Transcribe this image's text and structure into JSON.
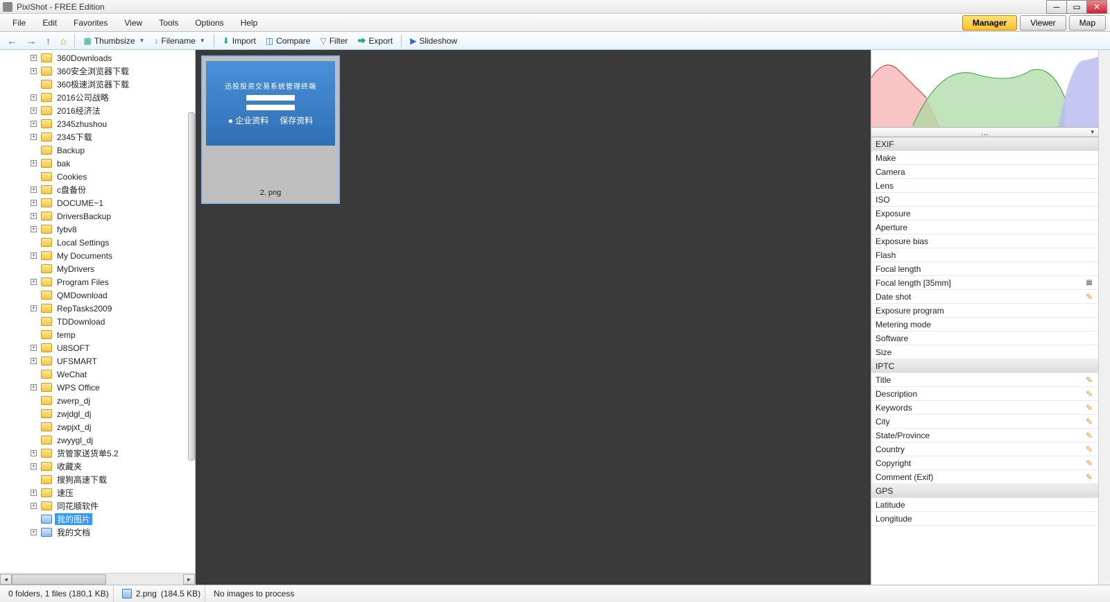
{
  "title": "PixiShot  -  FREE Edition",
  "menus": [
    "File",
    "Edit",
    "Favorites",
    "View",
    "Tools",
    "Options",
    "Help"
  ],
  "modes": [
    {
      "label": "Manager",
      "active": true
    },
    {
      "label": "Viewer",
      "active": false
    },
    {
      "label": "Map",
      "active": false
    }
  ],
  "toolbar": {
    "thumbsize": "Thumbsize",
    "filename": "Filename",
    "import": "Import",
    "compare": "Compare",
    "filter": "Filter",
    "export": "Export",
    "slideshow": "Slideshow"
  },
  "tree": [
    {
      "label": "360Downloads",
      "exp": "+"
    },
    {
      "label": "360安全浏览器下载",
      "exp": "+"
    },
    {
      "label": "360极速浏览器下载",
      "exp": ""
    },
    {
      "label": "2016公司战略",
      "exp": "+"
    },
    {
      "label": "2016经济法",
      "exp": "+"
    },
    {
      "label": "2345zhushou",
      "exp": "+"
    },
    {
      "label": "2345下载",
      "exp": "+"
    },
    {
      "label": "Backup",
      "exp": ""
    },
    {
      "label": "bak",
      "exp": "+"
    },
    {
      "label": "Cookies",
      "exp": ""
    },
    {
      "label": "c盘备份",
      "exp": "+"
    },
    {
      "label": "DOCUME~1",
      "exp": "+"
    },
    {
      "label": "DriversBackup",
      "exp": "+"
    },
    {
      "label": "fybv8",
      "exp": "+"
    },
    {
      "label": "Local Settings",
      "exp": ""
    },
    {
      "label": "My Documents",
      "exp": "+"
    },
    {
      "label": "MyDrivers",
      "exp": ""
    },
    {
      "label": "Program Files",
      "exp": "+"
    },
    {
      "label": "QMDownload",
      "exp": ""
    },
    {
      "label": "RepTasks2009",
      "exp": "+"
    },
    {
      "label": "TDDownload",
      "exp": ""
    },
    {
      "label": "temp",
      "exp": ""
    },
    {
      "label": "U8SOFT",
      "exp": "+"
    },
    {
      "label": "UFSMART",
      "exp": "+"
    },
    {
      "label": "WeChat",
      "exp": ""
    },
    {
      "label": "WPS Office",
      "exp": "+"
    },
    {
      "label": "zwerp_dj",
      "exp": ""
    },
    {
      "label": "zwjdgl_dj",
      "exp": ""
    },
    {
      "label": "zwpjxt_dj",
      "exp": ""
    },
    {
      "label": "zwyygl_dj",
      "exp": ""
    },
    {
      "label": "货管家送货单5.2",
      "exp": "+"
    },
    {
      "label": "收藏夹",
      "exp": "+"
    },
    {
      "label": "搜狗高速下载",
      "exp": ""
    },
    {
      "label": "速压",
      "exp": "+"
    },
    {
      "label": "同花顺软件",
      "exp": "+"
    },
    {
      "label": "我的图片",
      "exp": "",
      "sel": true,
      "pic": true
    },
    {
      "label": "我的文档",
      "exp": "+",
      "pic": true
    }
  ],
  "thumbnail": {
    "caption": "2. png",
    "inner": "迅投投资交易系统管理终端"
  },
  "histo_dd": "...",
  "meta": [
    {
      "label": "EXIF",
      "header": true
    },
    {
      "label": "Make"
    },
    {
      "label": "Camera"
    },
    {
      "label": "Lens"
    },
    {
      "label": "ISO"
    },
    {
      "label": "Exposure"
    },
    {
      "label": "Aperture"
    },
    {
      "label": "Exposure bias"
    },
    {
      "label": "Flash"
    },
    {
      "label": "Focal length"
    },
    {
      "label": "Focal length [35mm]",
      "calc": true
    },
    {
      "label": "Date shot",
      "edit": true
    },
    {
      "label": "Exposure program"
    },
    {
      "label": "Metering mode"
    },
    {
      "label": "Software"
    },
    {
      "label": "Size"
    },
    {
      "label": "IPTC",
      "header": true
    },
    {
      "label": "Title",
      "edit": true
    },
    {
      "label": "Description",
      "edit": true
    },
    {
      "label": "Keywords",
      "edit": true
    },
    {
      "label": "City",
      "edit": true
    },
    {
      "label": "State/Province",
      "edit": true
    },
    {
      "label": "Country",
      "edit": true
    },
    {
      "label": "Copyright",
      "edit": true
    },
    {
      "label": "Comment (Exif)",
      "edit": true
    },
    {
      "label": "GPS",
      "header": true
    },
    {
      "label": "Latitude"
    },
    {
      "label": "Longitude"
    }
  ],
  "status": {
    "counts": "0 folders,  1 files  (180,1 KB)",
    "file": "2.png",
    "size": "(184.5 KB)",
    "proc": "No images to process"
  }
}
